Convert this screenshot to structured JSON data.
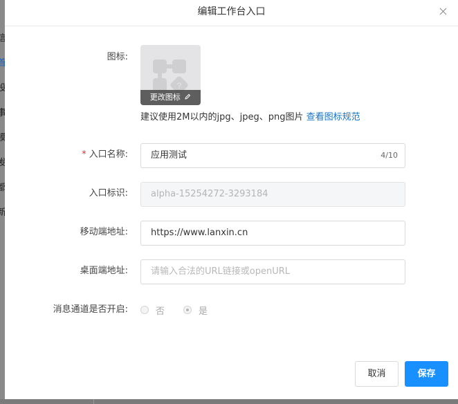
{
  "background": {
    "side_chars": [
      "信",
      "首",
      "投",
      "事",
      "模",
      "发",
      "都",
      "新"
    ]
  },
  "dialog": {
    "title": "编辑工作台入口",
    "close_icon": "close-icon"
  },
  "form": {
    "icon_label": "图标:",
    "icon_overlay_text": "更改图标",
    "icon_edit_icon": "pencil-icon",
    "icon_hint": "建议使用2M以内的jpg、jpeg、png图片",
    "icon_hint_link": "查看图标规范",
    "name_required_mark": "*",
    "name_label": "入口名称:",
    "name_value": "应用测试",
    "name_counter": "4/10",
    "id_label": "入口标识:",
    "id_value": "alpha-15254272-3293184",
    "mobile_label": "移动端地址:",
    "mobile_value": "https://www.lanxin.cn",
    "desktop_label": "桌面端地址:",
    "desktop_placeholder": "请输入合法的URL链接或openURL",
    "channel_label": "消息通道是否开启:",
    "channel_options": [
      "否",
      "是"
    ],
    "channel_selected": "是"
  },
  "footer": {
    "cancel_label": "取消",
    "save_label": "保存"
  },
  "colors": {
    "primary": "#1890ff",
    "link": "#1673c4",
    "required": "#f5222d"
  }
}
